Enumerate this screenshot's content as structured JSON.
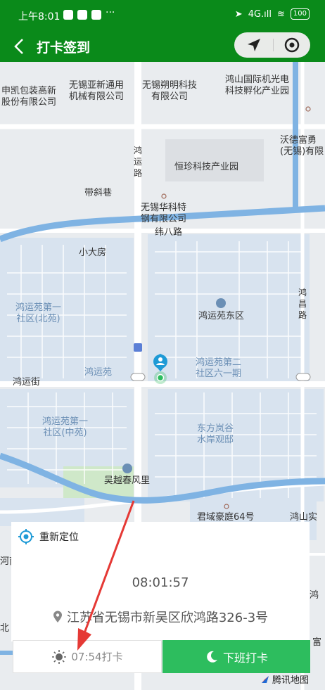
{
  "status": {
    "time": "上午8:01",
    "dots": "···",
    "signal": "4G.ıll",
    "battery": "100"
  },
  "nav": {
    "title": "打卡签到"
  },
  "map_labels": {
    "a": "申凯包装高新\n股份有限公司",
    "b": "无锡亚新通用\n机械有限公司",
    "c": "无锡朔明科技\n有限公司",
    "d": "鸿山国际机光电\n科技孵化产业园",
    "e": "沃德富勇\n(无锡)有限",
    "f": "鸿\n运\n路",
    "g": "恒珍科技产业园",
    "h": "带斜巷",
    "i": "无锡华科特\n钢有限公司",
    "j": "纬八路",
    "k": "小大房",
    "l": "鸿运苑第一\n社区(北苑)",
    "m": "鸿运苑东区",
    "n": "鸿\n昌\n路",
    "o": "鸿运苑",
    "p": "鸿运苑第二\n社区六一期",
    "q": "鸿运街",
    "r": "鸿运苑第一\n社区(中苑)",
    "s": "东方岚谷\n水岸观邸",
    "t": "吴越春风里",
    "u": "君域豪庭64号",
    "v": "鸿山实",
    "w": "河南",
    "x": "鸿",
    "y": "北",
    "z": "富"
  },
  "card": {
    "relocate_label": "重新定位",
    "time": "08:01:57",
    "address": "江苏省无锡市新吴区欣鸿路326-3号"
  },
  "buttons": {
    "clock_in_label": "07:54打卡",
    "clock_out_label": "下班打卡"
  },
  "map_logo": "腾讯地图",
  "colors": {
    "topbar": "#0a8a1a",
    "clock_out": "#2dbd5e",
    "arrow": "#e53935"
  }
}
